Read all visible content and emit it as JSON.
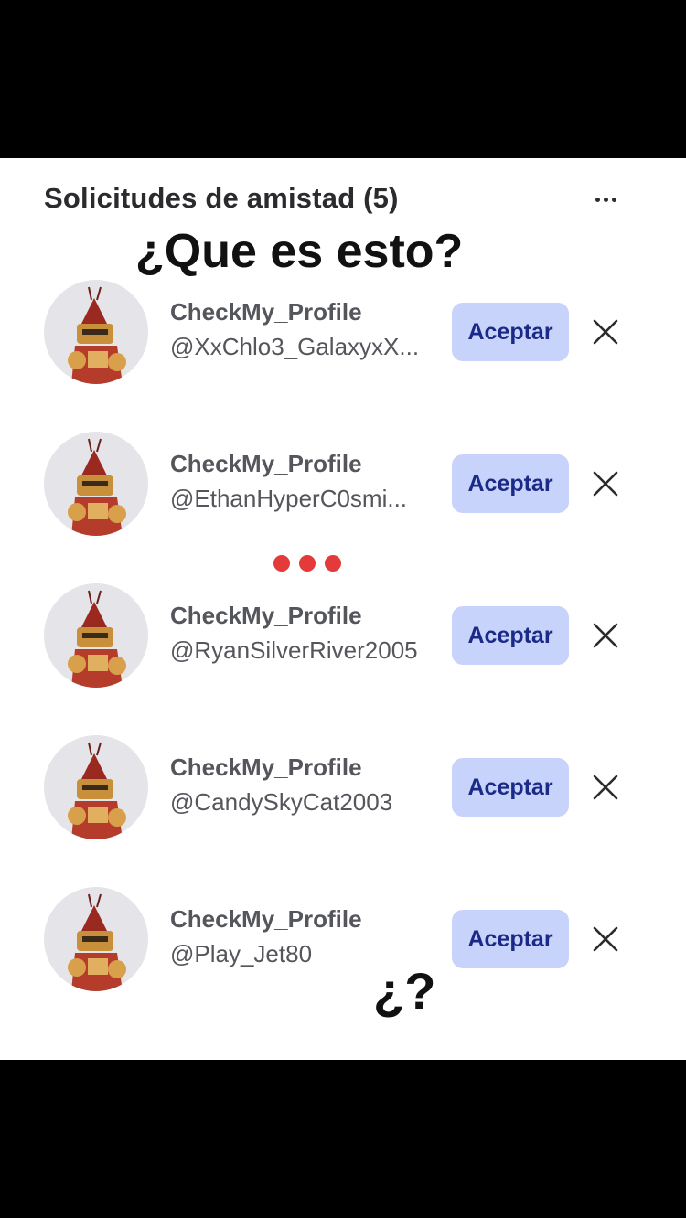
{
  "header": {
    "title": "Solicitudes de amistad (5)",
    "more_icon": "more-horizontal-icon"
  },
  "overlay": {
    "main_text": "¿Que es esto?",
    "question_text": "¿?",
    "dots_color": "#e53a3a"
  },
  "requests": [
    {
      "display_name": "CheckMy_Profile",
      "username": "@XxChlo3_GalaxyxX...",
      "accept_label": "Aceptar"
    },
    {
      "display_name": "CheckMy_Profile",
      "username": "@EthanHyperC0smi...",
      "accept_label": "Aceptar"
    },
    {
      "display_name": "CheckMy_Profile",
      "username": "@RyanSilverRiver2005",
      "accept_label": "Aceptar"
    },
    {
      "display_name": "CheckMy_Profile",
      "username": "@CandySkyCat2003",
      "accept_label": "Aceptar"
    },
    {
      "display_name": "CheckMy_Profile",
      "username": "@Play_Jet80",
      "accept_label": "Aceptar"
    }
  ],
  "colors": {
    "accept_bg": "#c7d3fb",
    "accept_text": "#1b2a86",
    "text": "#55565c"
  }
}
